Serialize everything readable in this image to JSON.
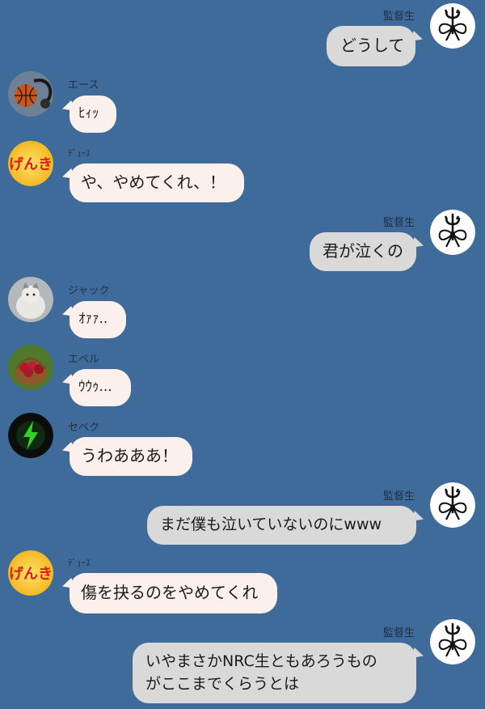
{
  "messages": [
    {
      "id": "m1",
      "side": "right",
      "sender": "監督生",
      "avatar": "ribbon-trident-icon",
      "text": [
        "どうして"
      ]
    },
    {
      "id": "m2",
      "side": "left",
      "sender": "エース",
      "avatar": "basketball-icon",
      "text": [
        "ﾋｨｯ"
      ]
    },
    {
      "id": "m3",
      "side": "left",
      "sender": "ﾃﾞｭｰｽ",
      "avatar": "genki-icon",
      "text": [
        "や、やめてくれ、！"
      ]
    },
    {
      "id": "m4",
      "side": "right",
      "sender": "監督生",
      "avatar": "ribbon-trident-icon",
      "text": [
        "君が泣くの"
      ]
    },
    {
      "id": "m5",
      "side": "left",
      "sender": "ジャック",
      "avatar": "cat-icon",
      "text": [
        "ｵｧｧ.."
      ]
    },
    {
      "id": "m6",
      "side": "left",
      "sender": "エペル",
      "avatar": "apple-basket-icon",
      "text": [
        "ｳｳｩ..."
      ]
    },
    {
      "id": "m7",
      "side": "left",
      "sender": "セベク",
      "avatar": "lightning-icon",
      "text": [
        "うわあああ！"
      ]
    },
    {
      "id": "m8",
      "side": "right",
      "sender": "監督生",
      "avatar": "ribbon-trident-icon",
      "text": [
        "まだ僕も泣いていないのにwww"
      ]
    },
    {
      "id": "m9",
      "side": "left",
      "sender": "ﾃﾞｭｰｽ",
      "avatar": "genki-icon",
      "text": [
        "傷を抉るのをやめてくれ"
      ]
    },
    {
      "id": "m10",
      "side": "right",
      "sender": "監督生",
      "avatar": "ribbon-trident-icon",
      "text": [
        "いやまさかNRC生ともあろうもの",
        "がここまでくらうとは"
      ]
    }
  ],
  "avatar_labels": {
    "genki": "げんき"
  },
  "colors": {
    "background": "#3f6b9a",
    "bubble_left": "#fbf0ec",
    "bubble_right": "#d9d9d9",
    "name_text": "#1f2f44"
  }
}
